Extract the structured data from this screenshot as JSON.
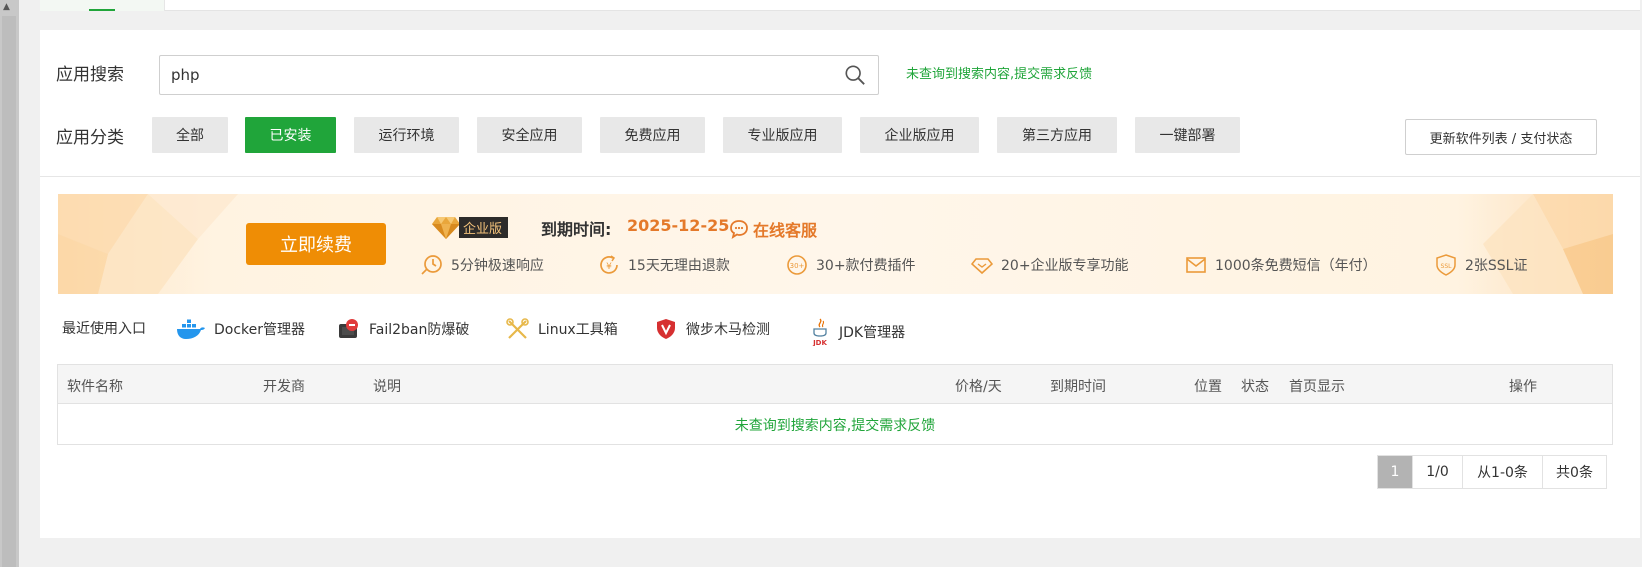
{
  "search": {
    "label": "应用搜索",
    "value": "php",
    "feedback": "未查询到搜索内容,提交需求反馈"
  },
  "categories": {
    "label": "应用分类",
    "items": [
      {
        "label": "全部",
        "active": false
      },
      {
        "label": "已安装",
        "active": true
      },
      {
        "label": "运行环境",
        "active": false
      },
      {
        "label": "安全应用",
        "active": false
      },
      {
        "label": "免费应用",
        "active": false
      },
      {
        "label": "专业版应用",
        "active": false
      },
      {
        "label": "企业版应用",
        "active": false
      },
      {
        "label": "第三方应用",
        "active": false
      },
      {
        "label": "一键部署",
        "active": false
      }
    ],
    "update_button": "更新软件列表 / 支付状态"
  },
  "banner": {
    "renew_button": "立即续费",
    "edition": "企业版",
    "expire_label": "到期时间:",
    "expire_date": "2025-12-25",
    "service": "在线客服",
    "features": [
      {
        "text": "5分钟极速响应",
        "icon": "clock-icon"
      },
      {
        "text": "15天无理由退款",
        "icon": "refund-icon"
      },
      {
        "text": "30+款付费插件",
        "icon": "plugin-icon"
      },
      {
        "text": "20+企业版专享功能",
        "icon": "diamond-icon"
      },
      {
        "text": "1000条免费短信（年付）",
        "icon": "mail-icon"
      },
      {
        "text": "2张SSL证",
        "icon": "ssl-icon"
      }
    ]
  },
  "recent": {
    "label": "最近使用入口",
    "items": [
      {
        "text": "Docker管理器",
        "icon": "docker-icon"
      },
      {
        "text": "Fail2ban防爆破",
        "icon": "fail2ban-icon"
      },
      {
        "text": "Linux工具箱",
        "icon": "tools-icon"
      },
      {
        "text": "微步木马检测",
        "icon": "shield-icon"
      },
      {
        "text": "JDK管理器",
        "icon": "java-icon"
      }
    ]
  },
  "table": {
    "columns": [
      "软件名称",
      "开发商",
      "说明",
      "价格/天",
      "到期时间",
      "位置",
      "状态",
      "首页显示",
      "操作"
    ],
    "empty_text": "未查询到搜索内容,提交需求反馈"
  },
  "pager": {
    "current": "1",
    "pages": "1/0",
    "range": "从1-0条",
    "total": "共0条"
  },
  "colors": {
    "primary": "#20a53a",
    "renew": "#ef8d05",
    "accent": "#e4792a"
  }
}
